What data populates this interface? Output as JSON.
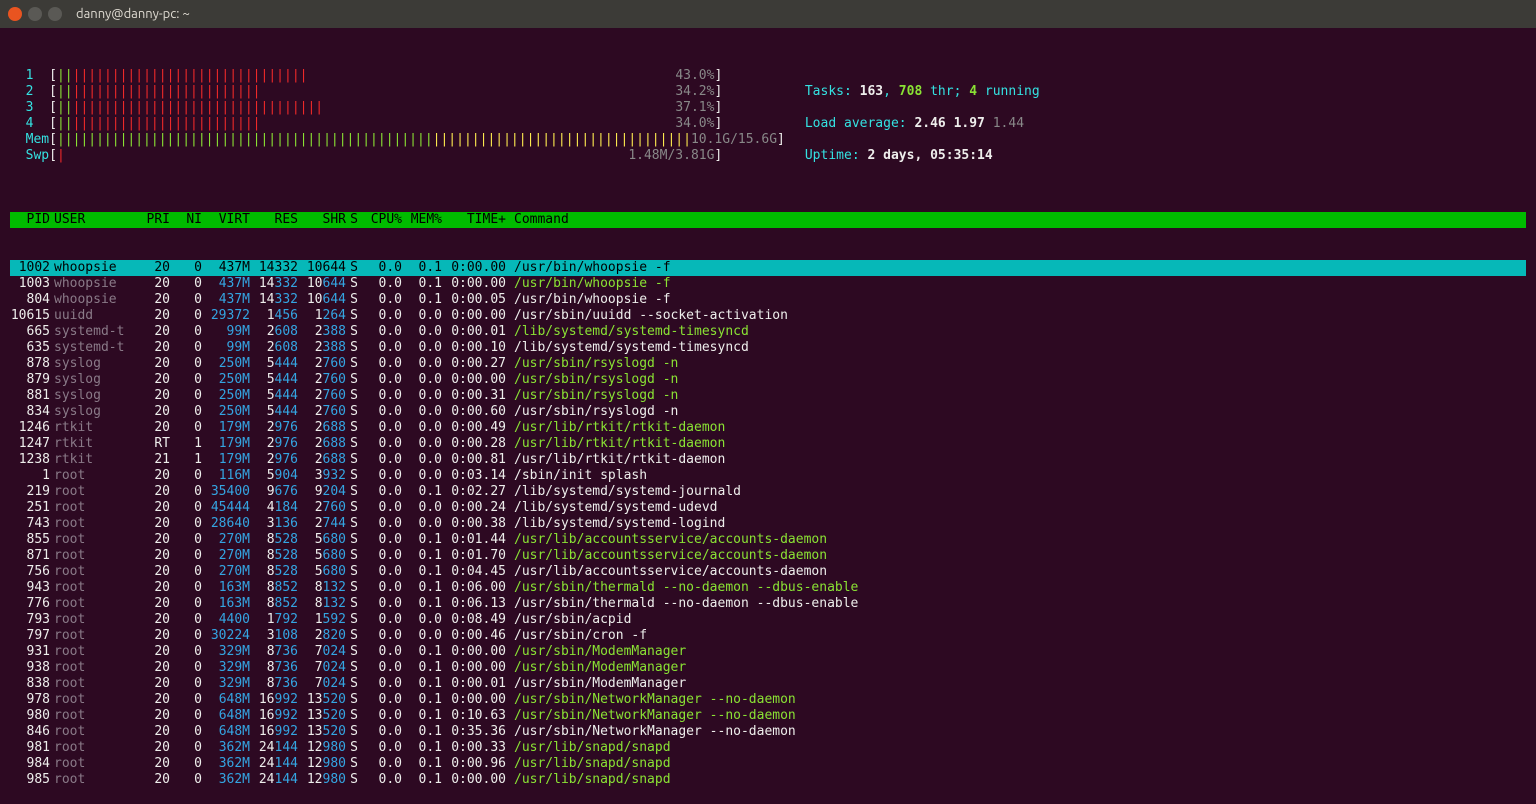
{
  "window": {
    "title": "danny@danny-pc: ~"
  },
  "cpu_meters": [
    {
      "label": "1",
      "bar": "||||||||||||||||||||||||||||||||",
      "bar_colors": [
        "green",
        "green",
        "red",
        "red",
        "red",
        "red",
        "red",
        "red",
        "red",
        "red",
        "red",
        "red",
        "red",
        "red",
        "red",
        "red",
        "red",
        "red",
        "red",
        "red",
        "red",
        "red",
        "red",
        "red",
        "red",
        "red",
        "red",
        "red",
        "red",
        "red",
        "red",
        "red"
      ],
      "pct": "43.0%"
    },
    {
      "label": "2",
      "bar": "||||||||||||||||||||||||||",
      "bar_colors": [
        "green",
        "green",
        "red",
        "red",
        "red",
        "red",
        "red",
        "red",
        "red",
        "red",
        "red",
        "red",
        "red",
        "red",
        "red",
        "red",
        "red",
        "red",
        "red",
        "red",
        "red",
        "red",
        "red",
        "red",
        "red",
        "red"
      ],
      "pct": "34.2%"
    },
    {
      "label": "3",
      "bar": "||||||||||||||||||||||||||||||||||",
      "bar_colors": [
        "green",
        "green",
        "red",
        "red",
        "red",
        "red",
        "red",
        "red",
        "red",
        "red",
        "red",
        "red",
        "red",
        "red",
        "red",
        "red",
        "red",
        "red",
        "red",
        "red",
        "red",
        "red",
        "red",
        "red",
        "red",
        "red",
        "red",
        "red",
        "red",
        "red",
        "red",
        "red",
        "red",
        "red"
      ],
      "pct": "37.1%"
    },
    {
      "label": "4",
      "bar": "||||||||||||||||||||||||||",
      "bar_colors": [
        "green",
        "green",
        "red",
        "red",
        "red",
        "red",
        "red",
        "red",
        "red",
        "red",
        "red",
        "red",
        "red",
        "red",
        "red",
        "red",
        "red",
        "red",
        "red",
        "red",
        "red",
        "red",
        "red",
        "red",
        "red",
        "red"
      ],
      "pct": "34.0%"
    }
  ],
  "mem": {
    "label": "Mem",
    "bar_green": "||||||||||||||||||||||||||||||||||||||||||||||||",
    "bar_yellow": "|||||||||||||||||||||||||||||||||",
    "text": "10.1G/15.6G"
  },
  "swp": {
    "label": "Swp",
    "bar_red": "|",
    "text": "1.48M/3.81G"
  },
  "summary": {
    "tasks_label": "Tasks:",
    "tasks": "163",
    "thr": "708",
    "thr_label": "thr;",
    "running": "4",
    "running_label": "running",
    "load_label": "Load average:",
    "load1": "2.46",
    "load2": "1.97",
    "load3": "1.44",
    "uptime_label": "Uptime:",
    "uptime": "2 days, 05:35:14"
  },
  "columns": {
    "pid": "PID",
    "user": "USER",
    "pri": "PRI",
    "ni": "NI",
    "virt": "VIRT",
    "res": "RES",
    "shr": "SHR",
    "s": "S",
    "cpu": "CPU%",
    "mem": "MEM%",
    "time": "TIME+",
    "cmd": "Command"
  },
  "processes": [
    {
      "pid": "1002",
      "user": "whoopsie",
      "pri": "20",
      "ni": "0",
      "virt": "437M",
      "res": "14332",
      "shr": "10644",
      "s": "S",
      "cpu": "0.0",
      "mem": "0.1",
      "time": "0:00.00",
      "cmd": "/usr/bin/whoopsie -f",
      "selected": true,
      "dim_cmd": false
    },
    {
      "pid": "1003",
      "user": "whoopsie",
      "pri": "20",
      "ni": "0",
      "virt": "437M",
      "res": "14332",
      "shr": "10644",
      "s": "S",
      "cpu": "0.0",
      "mem": "0.1",
      "time": "0:00.00",
      "cmd": "/usr/bin/whoopsie -f",
      "dim_cmd": true
    },
    {
      "pid": "804",
      "user": "whoopsie",
      "pri": "20",
      "ni": "0",
      "virt": "437M",
      "res": "14332",
      "shr": "10644",
      "s": "S",
      "cpu": "0.0",
      "mem": "0.1",
      "time": "0:00.05",
      "cmd": "/usr/bin/whoopsie -f",
      "dim_cmd": false
    },
    {
      "pid": "10615",
      "user": "uuidd",
      "pri": "20",
      "ni": "0",
      "virt": "29372",
      "res": "1456",
      "shr": "1264",
      "s": "S",
      "cpu": "0.0",
      "mem": "0.0",
      "time": "0:00.00",
      "cmd": "/usr/sbin/uuidd --socket-activation",
      "dim_cmd": false
    },
    {
      "pid": "665",
      "user": "systemd-t",
      "pri": "20",
      "ni": "0",
      "virt": "99M",
      "res": "2608",
      "shr": "2388",
      "s": "S",
      "cpu": "0.0",
      "mem": "0.0",
      "time": "0:00.01",
      "cmd": "/lib/systemd/systemd-timesyncd",
      "dim_cmd": true
    },
    {
      "pid": "635",
      "user": "systemd-t",
      "pri": "20",
      "ni": "0",
      "virt": "99M",
      "res": "2608",
      "shr": "2388",
      "s": "S",
      "cpu": "0.0",
      "mem": "0.0",
      "time": "0:00.10",
      "cmd": "/lib/systemd/systemd-timesyncd",
      "dim_cmd": false
    },
    {
      "pid": "878",
      "user": "syslog",
      "pri": "20",
      "ni": "0",
      "virt": "250M",
      "res": "5444",
      "shr": "2760",
      "s": "S",
      "cpu": "0.0",
      "mem": "0.0",
      "time": "0:00.27",
      "cmd": "/usr/sbin/rsyslogd -n",
      "dim_cmd": true
    },
    {
      "pid": "879",
      "user": "syslog",
      "pri": "20",
      "ni": "0",
      "virt": "250M",
      "res": "5444",
      "shr": "2760",
      "s": "S",
      "cpu": "0.0",
      "mem": "0.0",
      "time": "0:00.00",
      "cmd": "/usr/sbin/rsyslogd -n",
      "dim_cmd": true
    },
    {
      "pid": "881",
      "user": "syslog",
      "pri": "20",
      "ni": "0",
      "virt": "250M",
      "res": "5444",
      "shr": "2760",
      "s": "S",
      "cpu": "0.0",
      "mem": "0.0",
      "time": "0:00.31",
      "cmd": "/usr/sbin/rsyslogd -n",
      "dim_cmd": true
    },
    {
      "pid": "834",
      "user": "syslog",
      "pri": "20",
      "ni": "0",
      "virt": "250M",
      "res": "5444",
      "shr": "2760",
      "s": "S",
      "cpu": "0.0",
      "mem": "0.0",
      "time": "0:00.60",
      "cmd": "/usr/sbin/rsyslogd -n",
      "dim_cmd": false
    },
    {
      "pid": "1246",
      "user": "rtkit",
      "pri": "20",
      "ni": "0",
      "virt": "179M",
      "res": "2976",
      "shr": "2688",
      "s": "S",
      "cpu": "0.0",
      "mem": "0.0",
      "time": "0:00.49",
      "cmd": "/usr/lib/rtkit/rtkit-daemon",
      "dim_cmd": true
    },
    {
      "pid": "1247",
      "user": "rtkit",
      "pri": "RT",
      "ni": "1",
      "virt": "179M",
      "res": "2976",
      "shr": "2688",
      "s": "S",
      "cpu": "0.0",
      "mem": "0.0",
      "time": "0:00.28",
      "cmd": "/usr/lib/rtkit/rtkit-daemon",
      "dim_cmd": true
    },
    {
      "pid": "1238",
      "user": "rtkit",
      "pri": "21",
      "ni": "1",
      "virt": "179M",
      "res": "2976",
      "shr": "2688",
      "s": "S",
      "cpu": "0.0",
      "mem": "0.0",
      "time": "0:00.81",
      "cmd": "/usr/lib/rtkit/rtkit-daemon",
      "dim_cmd": false
    },
    {
      "pid": "1",
      "user": "root",
      "pri": "20",
      "ni": "0",
      "virt": "116M",
      "res": "5904",
      "shr": "3932",
      "s": "S",
      "cpu": "0.0",
      "mem": "0.0",
      "time": "0:03.14",
      "cmd": "/sbin/init splash",
      "dim_cmd": false
    },
    {
      "pid": "219",
      "user": "root",
      "pri": "20",
      "ni": "0",
      "virt": "35400",
      "res": "9676",
      "shr": "9204",
      "s": "S",
      "cpu": "0.0",
      "mem": "0.1",
      "time": "0:02.27",
      "cmd": "/lib/systemd/systemd-journald",
      "dim_cmd": false
    },
    {
      "pid": "251",
      "user": "root",
      "pri": "20",
      "ni": "0",
      "virt": "45444",
      "res": "4184",
      "shr": "2760",
      "s": "S",
      "cpu": "0.0",
      "mem": "0.0",
      "time": "0:00.24",
      "cmd": "/lib/systemd/systemd-udevd",
      "dim_cmd": false
    },
    {
      "pid": "743",
      "user": "root",
      "pri": "20",
      "ni": "0",
      "virt": "28640",
      "res": "3136",
      "shr": "2744",
      "s": "S",
      "cpu": "0.0",
      "mem": "0.0",
      "time": "0:00.38",
      "cmd": "/lib/systemd/systemd-logind",
      "dim_cmd": false
    },
    {
      "pid": "855",
      "user": "root",
      "pri": "20",
      "ni": "0",
      "virt": "270M",
      "res": "8528",
      "shr": "5680",
      "s": "S",
      "cpu": "0.0",
      "mem": "0.1",
      "time": "0:01.44",
      "cmd": "/usr/lib/accountsservice/accounts-daemon",
      "dim_cmd": true
    },
    {
      "pid": "871",
      "user": "root",
      "pri": "20",
      "ni": "0",
      "virt": "270M",
      "res": "8528",
      "shr": "5680",
      "s": "S",
      "cpu": "0.0",
      "mem": "0.1",
      "time": "0:01.70",
      "cmd": "/usr/lib/accountsservice/accounts-daemon",
      "dim_cmd": true
    },
    {
      "pid": "756",
      "user": "root",
      "pri": "20",
      "ni": "0",
      "virt": "270M",
      "res": "8528",
      "shr": "5680",
      "s": "S",
      "cpu": "0.0",
      "mem": "0.1",
      "time": "0:04.45",
      "cmd": "/usr/lib/accountsservice/accounts-daemon",
      "dim_cmd": false
    },
    {
      "pid": "943",
      "user": "root",
      "pri": "20",
      "ni": "0",
      "virt": "163M",
      "res": "8852",
      "shr": "8132",
      "s": "S",
      "cpu": "0.0",
      "mem": "0.1",
      "time": "0:06.00",
      "cmd": "/usr/sbin/thermald --no-daemon --dbus-enable",
      "dim_cmd": true
    },
    {
      "pid": "776",
      "user": "root",
      "pri": "20",
      "ni": "0",
      "virt": "163M",
      "res": "8852",
      "shr": "8132",
      "s": "S",
      "cpu": "0.0",
      "mem": "0.1",
      "time": "0:06.13",
      "cmd": "/usr/sbin/thermald --no-daemon --dbus-enable",
      "dim_cmd": false
    },
    {
      "pid": "793",
      "user": "root",
      "pri": "20",
      "ni": "0",
      "virt": "4400",
      "res": "1792",
      "shr": "1592",
      "s": "S",
      "cpu": "0.0",
      "mem": "0.0",
      "time": "0:08.49",
      "cmd": "/usr/sbin/acpid",
      "dim_cmd": false
    },
    {
      "pid": "797",
      "user": "root",
      "pri": "20",
      "ni": "0",
      "virt": "30224",
      "res": "3108",
      "shr": "2820",
      "s": "S",
      "cpu": "0.0",
      "mem": "0.0",
      "time": "0:00.46",
      "cmd": "/usr/sbin/cron -f",
      "dim_cmd": false
    },
    {
      "pid": "931",
      "user": "root",
      "pri": "20",
      "ni": "0",
      "virt": "329M",
      "res": "8736",
      "shr": "7024",
      "s": "S",
      "cpu": "0.0",
      "mem": "0.1",
      "time": "0:00.00",
      "cmd": "/usr/sbin/ModemManager",
      "dim_cmd": true
    },
    {
      "pid": "938",
      "user": "root",
      "pri": "20",
      "ni": "0",
      "virt": "329M",
      "res": "8736",
      "shr": "7024",
      "s": "S",
      "cpu": "0.0",
      "mem": "0.1",
      "time": "0:00.00",
      "cmd": "/usr/sbin/ModemManager",
      "dim_cmd": true
    },
    {
      "pid": "838",
      "user": "root",
      "pri": "20",
      "ni": "0",
      "virt": "329M",
      "res": "8736",
      "shr": "7024",
      "s": "S",
      "cpu": "0.0",
      "mem": "0.1",
      "time": "0:00.01",
      "cmd": "/usr/sbin/ModemManager",
      "dim_cmd": false
    },
    {
      "pid": "978",
      "user": "root",
      "pri": "20",
      "ni": "0",
      "virt": "648M",
      "res": "16992",
      "shr": "13520",
      "s": "S",
      "cpu": "0.0",
      "mem": "0.1",
      "time": "0:00.00",
      "cmd": "/usr/sbin/NetworkManager --no-daemon",
      "dim_cmd": true
    },
    {
      "pid": "980",
      "user": "root",
      "pri": "20",
      "ni": "0",
      "virt": "648M",
      "res": "16992",
      "shr": "13520",
      "s": "S",
      "cpu": "0.0",
      "mem": "0.1",
      "time": "0:10.63",
      "cmd": "/usr/sbin/NetworkManager --no-daemon",
      "dim_cmd": true
    },
    {
      "pid": "846",
      "user": "root",
      "pri": "20",
      "ni": "0",
      "virt": "648M",
      "res": "16992",
      "shr": "13520",
      "s": "S",
      "cpu": "0.0",
      "mem": "0.1",
      "time": "0:35.36",
      "cmd": "/usr/sbin/NetworkManager --no-daemon",
      "dim_cmd": false
    },
    {
      "pid": "981",
      "user": "root",
      "pri": "20",
      "ni": "0",
      "virt": "362M",
      "res": "24144",
      "shr": "12980",
      "s": "S",
      "cpu": "0.0",
      "mem": "0.1",
      "time": "0:00.33",
      "cmd": "/usr/lib/snapd/snapd",
      "dim_cmd": true
    },
    {
      "pid": "984",
      "user": "root",
      "pri": "20",
      "ni": "0",
      "virt": "362M",
      "res": "24144",
      "shr": "12980",
      "s": "S",
      "cpu": "0.0",
      "mem": "0.1",
      "time": "0:00.96",
      "cmd": "/usr/lib/snapd/snapd",
      "dim_cmd": true
    },
    {
      "pid": "985",
      "user": "root",
      "pri": "20",
      "ni": "0",
      "virt": "362M",
      "res": "24144",
      "shr": "12980",
      "s": "S",
      "cpu": "0.0",
      "mem": "0.1",
      "time": "0:00.00",
      "cmd": "/usr/lib/snapd/snapd",
      "dim_cmd": true
    }
  ]
}
